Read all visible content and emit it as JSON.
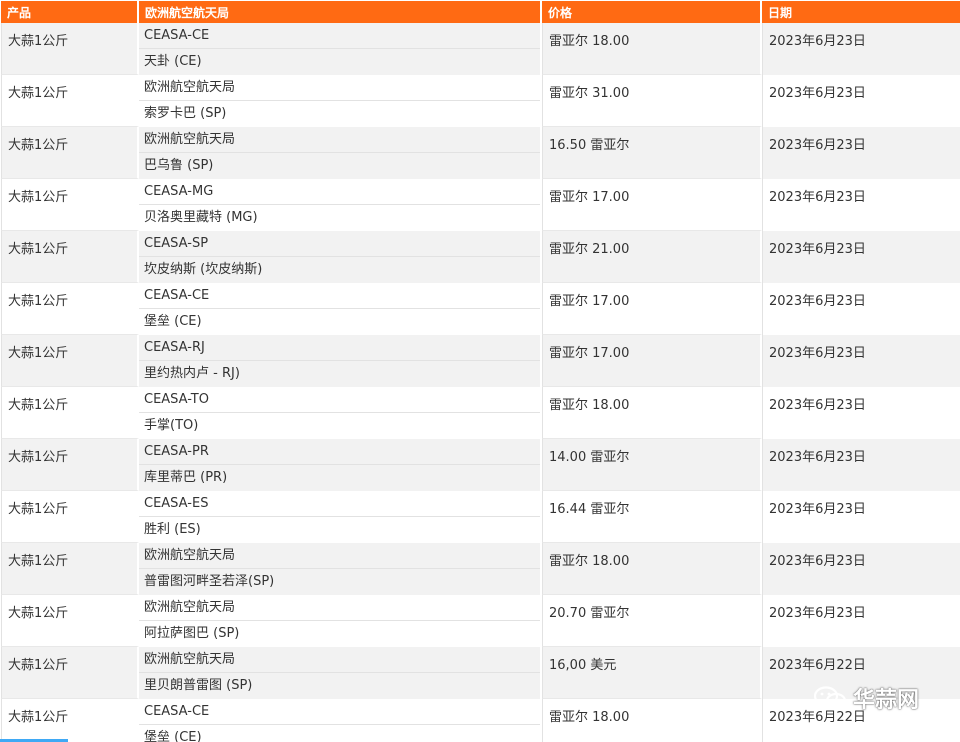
{
  "table": {
    "headers": {
      "product": "产品",
      "market": "欧洲航空航天局",
      "price": "价格",
      "date": "日期"
    },
    "rows": [
      {
        "product": "大蒜1公斤",
        "market": "CEASA-CE",
        "city": "天卦 (CE)",
        "price": "雷亚尔 18.00",
        "date": "2023年6月23日"
      },
      {
        "product": "大蒜1公斤",
        "market": "欧洲航空航天局",
        "city": "索罗卡巴 (SP)",
        "price": "雷亚尔 31.00",
        "date": "2023年6月23日"
      },
      {
        "product": "大蒜1公斤",
        "market": "欧洲航空航天局",
        "city": "巴乌鲁 (SP)",
        "price": "16.50 雷亚尔",
        "date": "2023年6月23日"
      },
      {
        "product": "大蒜1公斤",
        "market": "CEASA-MG",
        "city": "贝洛奥里藏特 (MG)",
        "price": "雷亚尔 17.00",
        "date": "2023年6月23日"
      },
      {
        "product": "大蒜1公斤",
        "market": "CEASA-SP",
        "city": "坎皮纳斯 (坎皮纳斯)",
        "price": "雷亚尔 21.00",
        "date": "2023年6月23日"
      },
      {
        "product": "大蒜1公斤",
        "market": "CEASA-CE",
        "city": "堡垒 (CE)",
        "price": "雷亚尔 17.00",
        "date": "2023年6月23日"
      },
      {
        "product": "大蒜1公斤",
        "market": "CEASA-RJ",
        "city": "里约热内卢 - RJ)",
        "price": "雷亚尔 17.00",
        "date": "2023年6月23日"
      },
      {
        "product": "大蒜1公斤",
        "market": "CEASA-TO",
        "city": "手掌(TO)",
        "price": "雷亚尔 18.00",
        "date": "2023年6月23日"
      },
      {
        "product": "大蒜1公斤",
        "market": "CEASA-PR",
        "city": "库里蒂巴 (PR)",
        "price": "14.00 雷亚尔",
        "date": "2023年6月23日"
      },
      {
        "product": "大蒜1公斤",
        "market": "CEASA-ES",
        "city": "胜利 (ES)",
        "price": "16.44 雷亚尔",
        "date": "2023年6月23日"
      },
      {
        "product": "大蒜1公斤",
        "market": "欧洲航空航天局",
        "city": "普雷图河畔圣若泽(SP)",
        "price": "雷亚尔 18.00",
        "date": "2023年6月23日"
      },
      {
        "product": "大蒜1公斤",
        "market": "欧洲航空航天局",
        "city": "阿拉萨图巴 (SP)",
        "price": "20.70 雷亚尔",
        "date": "2023年6月23日"
      },
      {
        "product": "大蒜1公斤",
        "market": "欧洲航空航天局",
        "city": "里贝朗普雷图 (SP)",
        "price": "16,00 美元",
        "date": "2023年6月22日"
      },
      {
        "product": "大蒜1公斤",
        "market": "CEASA-CE",
        "city": "堡垒 (CE)",
        "price": "雷亚尔 18.00",
        "date": "2023年6月22日"
      }
    ]
  },
  "watermark": {
    "text": "华蒜网",
    "icon": "wechat-icon"
  },
  "colors": {
    "header_bg": "#ff6a13",
    "row_alt_bg": "#f2f2f2",
    "scroll_accent": "#3fa9f5"
  }
}
